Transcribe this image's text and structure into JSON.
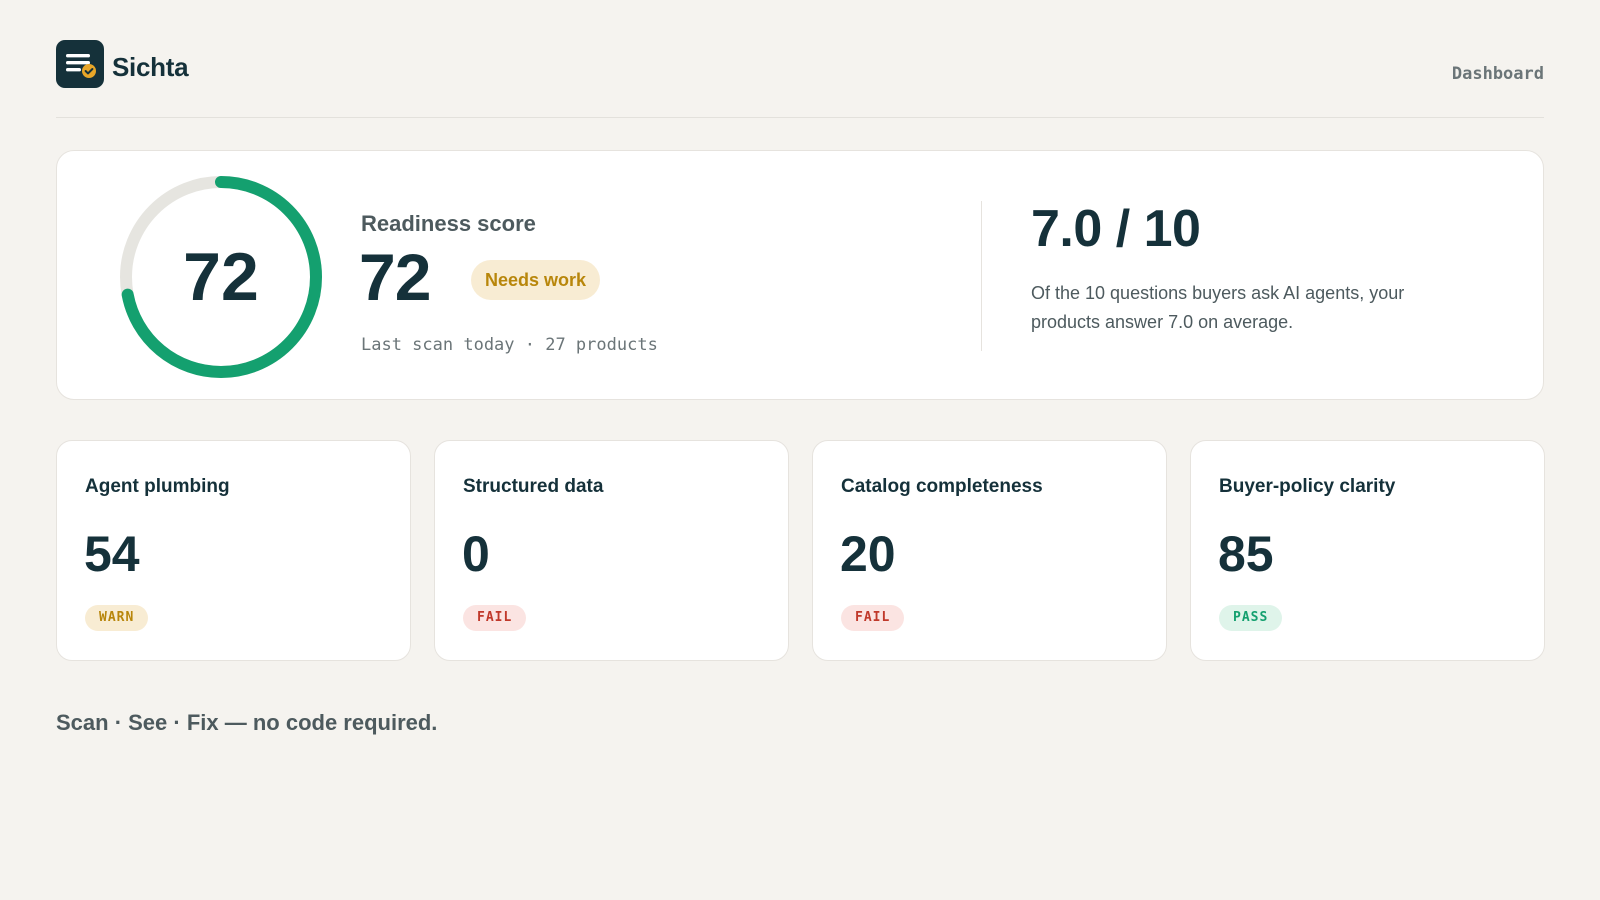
{
  "brand": {
    "name": "Sichta",
    "logo_icon": "checklist-check-icon"
  },
  "nav": {
    "dashboard_link": "Dashboard"
  },
  "readiness": {
    "ring_value": "72",
    "ring_fraction": 0.72,
    "label": "Readiness score",
    "score": "72",
    "status": "Needs work",
    "meta": "Last scan today · 27 products"
  },
  "answers": {
    "score": "7.0 / 10",
    "description": "Of the 10 questions buyers ask AI agents, your products answer 7.0 on average."
  },
  "categories": [
    {
      "title": "Agent plumbing",
      "value": "54",
      "status": "WARN"
    },
    {
      "title": "Structured data",
      "value": "0",
      "status": "FAIL"
    },
    {
      "title": "Catalog completeness",
      "value": "20",
      "status": "FAIL"
    },
    {
      "title": "Buyer-policy clarity",
      "value": "85",
      "status": "PASS"
    }
  ],
  "tagline": "Scan · See · Fix — no code required.",
  "colors": {
    "ring": "#14a06f",
    "ring_track": "#e6e5e0",
    "warn_bg": "#f8ecd3",
    "warn_text": "#b8860b",
    "fail_bg": "#fbe4e2",
    "fail_text": "#c0392b",
    "pass_bg": "#dff4ea",
    "pass_text": "#14a06f"
  }
}
